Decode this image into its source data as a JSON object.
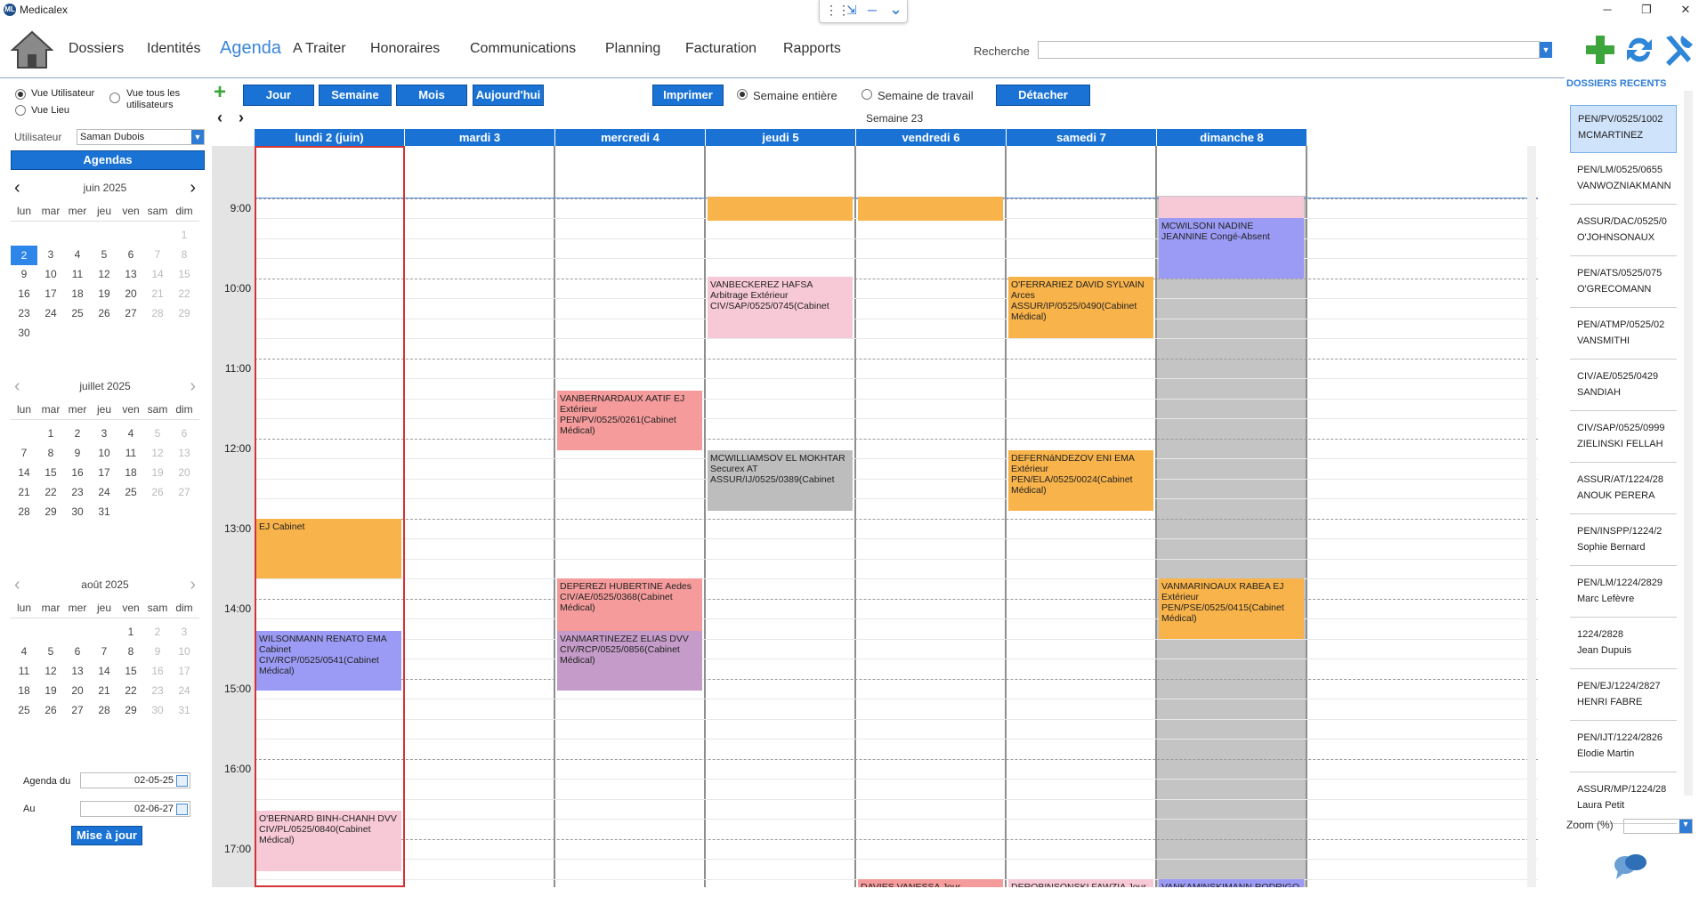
{
  "app": {
    "title": "Medicalex",
    "logo": "ML"
  },
  "window": {
    "minimize": "─",
    "restore": "❐",
    "close": "✕"
  },
  "floatbar": {
    "grid_icon": "⋮⋮",
    "collapse_icon": "⇲",
    "min_icon": "─",
    "chevron_icon": "⌄"
  },
  "nav": {
    "items": [
      "Dossiers",
      "Identités",
      "Agenda",
      "A Traiter",
      "Honoraires",
      "Communications",
      "Planning",
      "Facturation",
      "Rapports"
    ],
    "active": "Agenda",
    "search_label": "Recherche",
    "search_value": ""
  },
  "left": {
    "radio_user": "Vue Utilisateur",
    "radio_all_line1": "Vue tous les",
    "radio_all_line2": "utilisateurs",
    "radio_lieu": "Vue Lieu",
    "user_label": "Utilisateur",
    "user_value": "Saman Dubois",
    "agendas_button": "Agendas",
    "dow": [
      "lun",
      "mar",
      "mer",
      "jeu",
      "ven",
      "sam",
      "dim"
    ],
    "agenda_du_label": "Agenda du",
    "agenda_du_value": "02-05-25",
    "au_label": "Au",
    "au_value": "02-06-27",
    "update_button": "Mise à jour"
  },
  "months": [
    {
      "name": "juin 2025",
      "weeks": [
        [
          "",
          "",
          "",
          "",
          "",
          "",
          "1"
        ],
        [
          "2",
          "3",
          "4",
          "5",
          "6",
          "7",
          "8"
        ],
        [
          "9",
          "10",
          "11",
          "12",
          "13",
          "14",
          "15"
        ],
        [
          "16",
          "17",
          "18",
          "19",
          "20",
          "21",
          "22"
        ],
        [
          "23",
          "24",
          "25",
          "26",
          "27",
          "28",
          "29"
        ],
        [
          "30",
          "",
          "",
          "",
          "",
          "",
          ""
        ]
      ],
      "selected": "2"
    },
    {
      "name": "juillet 2025",
      "weeks": [
        [
          "",
          "1",
          "2",
          "3",
          "4",
          "5",
          "6"
        ],
        [
          "7",
          "8",
          "9",
          "10",
          "11",
          "12",
          "13"
        ],
        [
          "14",
          "15",
          "16",
          "17",
          "18",
          "19",
          "20"
        ],
        [
          "21",
          "22",
          "23",
          "24",
          "25",
          "26",
          "27"
        ],
        [
          "28",
          "29",
          "30",
          "31",
          "",
          "",
          ""
        ]
      ],
      "selected": ""
    },
    {
      "name": "août 2025",
      "weeks": [
        [
          "",
          "",
          "",
          "",
          "1",
          "2",
          "3"
        ],
        [
          "4",
          "5",
          "6",
          "7",
          "8",
          "9",
          "10"
        ],
        [
          "11",
          "12",
          "13",
          "14",
          "15",
          "16",
          "17"
        ],
        [
          "18",
          "19",
          "20",
          "21",
          "22",
          "23",
          "24"
        ],
        [
          "25",
          "26",
          "27",
          "28",
          "29",
          "30",
          "31"
        ]
      ],
      "selected": ""
    }
  ],
  "toolbar": {
    "add_icon": "+",
    "jour": "Jour",
    "semaine": "Semaine",
    "mois": "Mois",
    "aujourdhui": "Aujourd'hui",
    "imprimer": "Imprimer",
    "semaine_entiere": "Semaine entière",
    "semaine_travail": "Semaine de travail",
    "detacher": "Détacher",
    "prev_icon": "‹",
    "next_icon": "›",
    "week_label": "Semaine 23"
  },
  "days": [
    "lundi 2 (juin)",
    "mardi 3",
    "mercredi 4",
    "jeudi 5",
    "vendredi 6",
    "samedi 7",
    "dimanche 8"
  ],
  "hours": [
    "9:00",
    "10:00",
    "11:00",
    "12:00",
    "13:00",
    "14:00",
    "15:00",
    "16:00",
    "17:00"
  ],
  "events": [
    {
      "day": 0,
      "start": 13.0,
      "end": 13.75,
      "color": "#f8b34a",
      "text": "EJ Cabinet"
    },
    {
      "day": 0,
      "start": 14.4,
      "end": 15.15,
      "color": "#9b9bf6",
      "text": "WILSONMANN RENATO EMA Cabinet CIV/RCP/0525/0541(Cabinet Médical)"
    },
    {
      "day": 0,
      "start": 16.65,
      "end": 17.4,
      "color": "#f7c9d6",
      "text": "O'BERNARD BINH-CHANH DVV CIV/PL/0525/0840(Cabinet Médical)"
    },
    {
      "day": 2,
      "start": 11.4,
      "end": 12.15,
      "color": "#f59b9b",
      "text": "VANBERNARDAUX AATIF EJ Extérieur PEN/PV/0525/0261(Cabinet Médical)"
    },
    {
      "day": 2,
      "start": 13.75,
      "end": 14.5,
      "color": "#f59b9b",
      "text": "DEPEREZI HUBERTINE Aedes CIV/AE/0525/0368(Cabinet Médical)"
    },
    {
      "day": 2,
      "start": 14.4,
      "end": 15.15,
      "color": "#c59cc9",
      "text": "VANMARTINEZEZ ELIAS DVV CIV/RCP/0525/0856(Cabinet Médical)"
    },
    {
      "day": 3,
      "start": 8.98,
      "end": 9.28,
      "color": "#f8b34a",
      "text": ""
    },
    {
      "day": 3,
      "start": 9.98,
      "end": 10.75,
      "color": "#f7c9d6",
      "text": "VANBECKEREZ HAFSA Arbitrage Extérieur CIV/SAP/0525/0745(Cabinet"
    },
    {
      "day": 3,
      "start": 12.15,
      "end": 12.9,
      "color": "#bdbdbd",
      "text": "MCWILLIAMSOV EL MOKHTAR Securex AT ASSUR/IJ/0525/0389(Cabinet"
    },
    {
      "day": 4,
      "start": 8.98,
      "end": 9.28,
      "color": "#f8b34a",
      "text": ""
    },
    {
      "day": 4,
      "start": 17.5,
      "end": 17.9,
      "color": "#f59b9b",
      "text": "DAVIES VANESSA Jour Opératoire"
    },
    {
      "day": 5,
      "start": 9.98,
      "end": 10.75,
      "color": "#f8b34a",
      "text": "O'FERRARIEZ DAVID SYLVAIN Arces ASSUR/IP/0525/0490(Cabinet Médical)"
    },
    {
      "day": 5,
      "start": 12.15,
      "end": 12.9,
      "color": "#f8b34a",
      "text": "DEFERNáNDEZOV ENI EMA Extérieur PEN/ELA/0525/0024(Cabinet Médical)"
    },
    {
      "day": 5,
      "start": 17.5,
      "end": 17.9,
      "color": "#f7c9d6",
      "text": "DEROBINSONSKI FAWZIA Jour"
    },
    {
      "day": 6,
      "start": 8.98,
      "end": 9.28,
      "color": "#f7c9d6",
      "text": ""
    },
    {
      "day": 6,
      "start": 9.25,
      "end": 10.0,
      "color": "#9b9bf6",
      "text": "MCWILSONI NADINE JEANNINE Congé-Absent"
    },
    {
      "day": 6,
      "start": 13.75,
      "end": 14.5,
      "color": "#f8b34a",
      "text": "VANMARINOAUX RABEA EJ Extérieur PEN/PSE/0525/0415(Cabinet Médical)"
    },
    {
      "day": 6,
      "start": 17.5,
      "end": 17.9,
      "color": "#9b9bf6",
      "text": "VANKAMINSKIMANN RODRIGO EMA"
    }
  ],
  "recent": {
    "title": "DOSSIERS RECENTS",
    "items": [
      {
        "ref": "PEN/PV/0525/1002",
        "name": "MCMARTINEZ",
        "selected": true
      },
      {
        "ref": "PEN/LM/0525/0655",
        "name": "VANWOZNIAKMANN"
      },
      {
        "ref": "ASSUR/DAC/0525/0",
        "name": "O'JOHNSONAUX"
      },
      {
        "ref": "PEN/ATS/0525/075",
        "name": "O'GRECOMANN"
      },
      {
        "ref": "PEN/ATMP/0525/02",
        "name": "VANSMITHI"
      },
      {
        "ref": "CIV/AE/0525/0429",
        "name": "SANDIAH"
      },
      {
        "ref": "CIV/SAP/0525/0999",
        "name": "ZIELINSKI FELLAH"
      },
      {
        "ref": "ASSUR/AT/1224/28",
        "name": "ANOUK PERERA"
      },
      {
        "ref": "PEN/INSPP/1224/2",
        "name": "Sophie Bernard"
      },
      {
        "ref": "PEN/LM/1224/2829",
        "name": "Marc Lefèvre"
      },
      {
        "ref": "1224/2828",
        "name": "Jean Dupuis"
      },
      {
        "ref": "PEN/EJ/1224/2827",
        "name": "HENRI FABRE"
      },
      {
        "ref": "PEN/IJT/1224/2826",
        "name": "Élodie Martin"
      },
      {
        "ref": "ASSUR/MP/1224/28",
        "name": "Laura Petit"
      }
    ],
    "zoom_label": "Zoom (%)",
    "zoom_value": ""
  },
  "colors": {
    "accent": "#1a73d4",
    "selected_day_border": "#d33333",
    "sunday_bg": "#c4c4c4"
  }
}
